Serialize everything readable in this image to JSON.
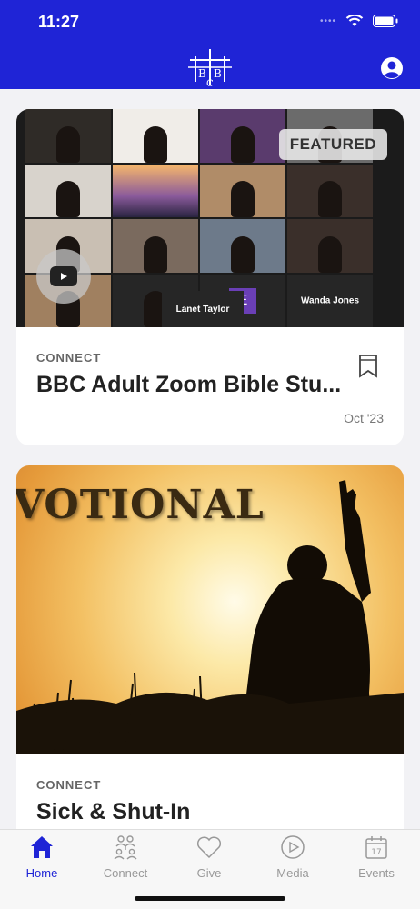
{
  "status_bar": {
    "time": "11:27"
  },
  "header": {
    "logo_text": "BBC"
  },
  "feed": {
    "cards": [
      {
        "category": "CONNECT",
        "title": "BBC Adult Zoom Bible Stu...",
        "date": "Oct '23",
        "featured_badge": "FEATURED",
        "thumbnail": {
          "tile_letter": "E",
          "name_tile_1": "Wanda Jones",
          "name_tile_2": "Lanet Taylor"
        }
      },
      {
        "category": "CONNECT",
        "title": "Sick & Shut-In",
        "thumbnail": {
          "overlay_text": "VOTIONAL"
        }
      }
    ]
  },
  "tabbar": {
    "active_color": "#1f24d6",
    "items": [
      {
        "label": "Home",
        "icon": "home-icon"
      },
      {
        "label": "Connect",
        "icon": "people-icon"
      },
      {
        "label": "Give",
        "icon": "heart-icon"
      },
      {
        "label": "Media",
        "icon": "play-circle-icon"
      },
      {
        "label": "Events",
        "icon": "calendar-icon"
      }
    ],
    "events_day": "17"
  }
}
